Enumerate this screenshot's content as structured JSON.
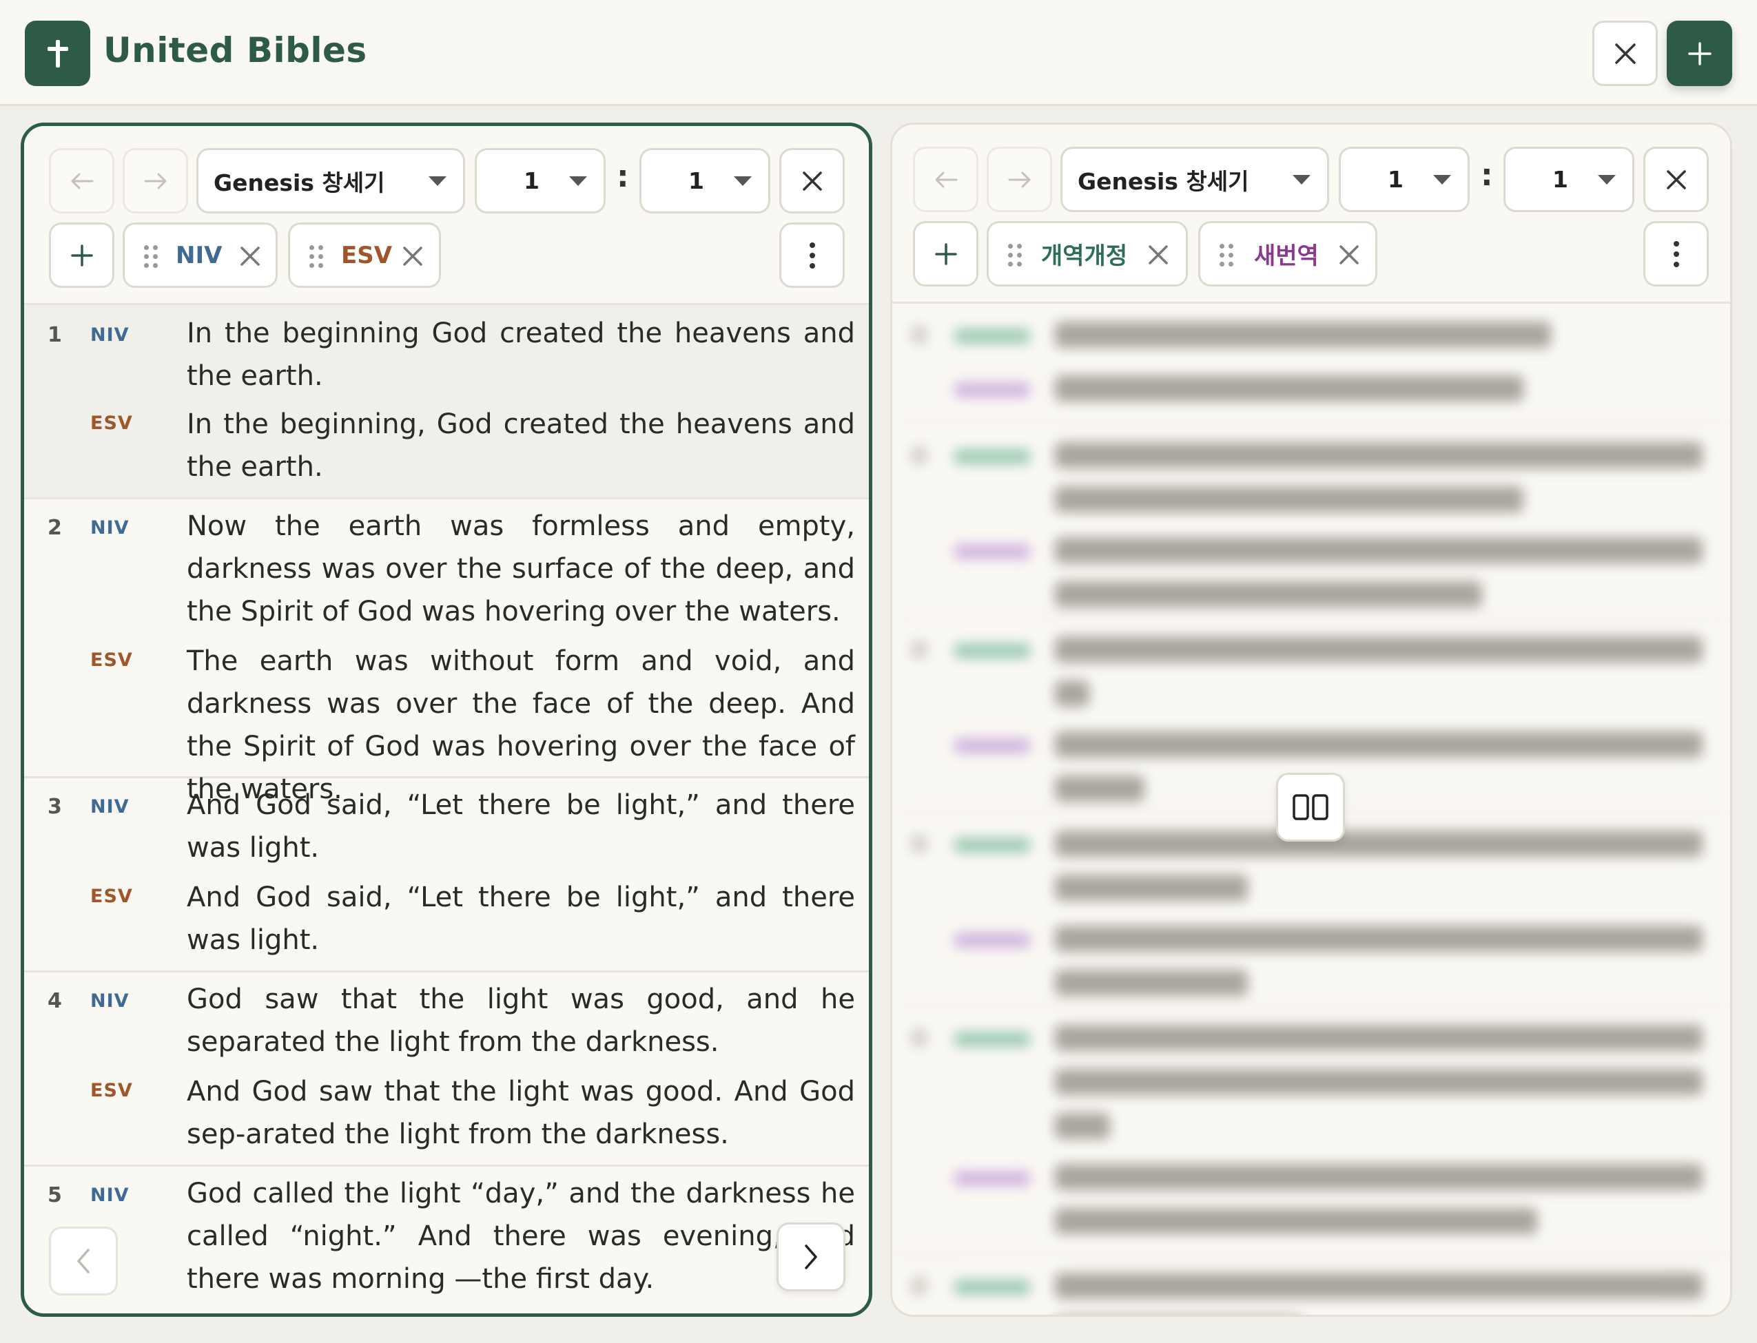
{
  "app": {
    "title": "United Bibles"
  },
  "colors": {
    "brand": "#2e5a48",
    "niv": "#3e6a94",
    "esv": "#a0562a",
    "kor1": "#2e6e58",
    "kor2": "#8a3a8e"
  },
  "left_panel": {
    "book": "Genesis 창세기",
    "chapter": "1",
    "verse": "1",
    "separator": ":",
    "translations": [
      {
        "label": "NIV"
      },
      {
        "label": "ESV"
      }
    ],
    "verses": [
      {
        "num": "1",
        "niv": "In the beginning God created the heavens and the earth.",
        "esv": "In the beginning, God created the heavens and the earth."
      },
      {
        "num": "2",
        "niv": "Now the earth was formless and empty, darkness was over the surface of the deep, and the Spirit of God was hovering over the waters.",
        "esv": "The earth was without form and void, and darkness was over the face of the deep. And the Spirit of God was hovering over the face of the waters."
      },
      {
        "num": "3",
        "niv": "And God said, “Let there be light,” and there was light.",
        "esv": "And God said, “Let there be light,” and there was light."
      },
      {
        "num": "4",
        "niv": "God saw that the light was good, and he separated the light from the darkness.",
        "esv": "And God saw that the light was good. And God sep-arated the light from the darkness."
      },
      {
        "num": "5",
        "niv": "God called the light “day,” and the darkness he called “night.” And there was evening, and there was morning —the first day."
      }
    ]
  },
  "right_panel": {
    "book": "Genesis 창세기",
    "chapter": "1",
    "verse": "1",
    "separator": ":",
    "translations": [
      {
        "label": "개역개정"
      },
      {
        "label": "새번역"
      }
    ]
  },
  "icons": [
    "cross-icon",
    "close-icon",
    "plus-icon",
    "arrow-left-icon",
    "arrow-right-icon",
    "caret-down-icon",
    "grip-icon",
    "more-vertical-icon",
    "chevron-left-icon",
    "chevron-right-icon",
    "compare-columns-icon"
  ]
}
